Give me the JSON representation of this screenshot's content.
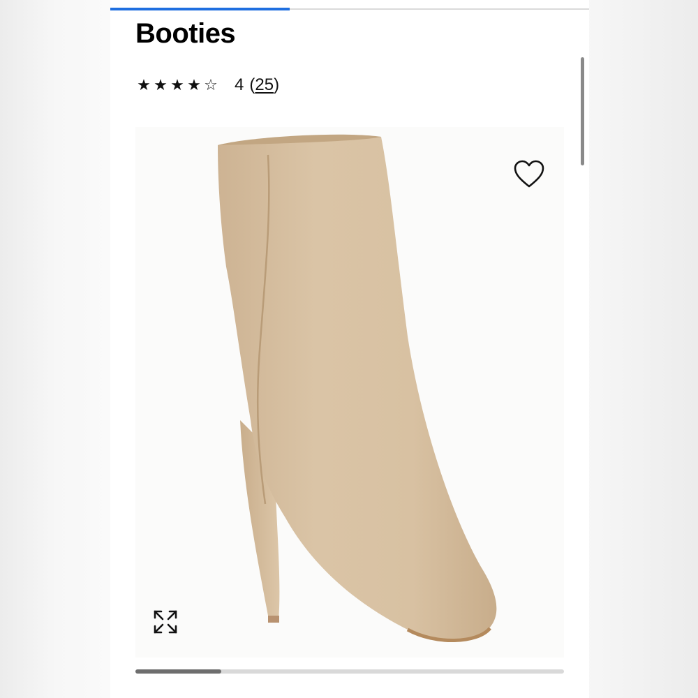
{
  "product": {
    "title": "Booties",
    "rating": {
      "stars_filled": 4,
      "stars_total": 5,
      "star_filled_glyph": "★",
      "star_empty_glyph": "☆",
      "value": "4",
      "count": "25",
      "count_open": "(",
      "count_close": ")"
    },
    "image": {
      "subject": "boot-photo",
      "boot_color": "#d9c2a4"
    }
  },
  "carousel": {
    "progress_fraction": 0.2
  },
  "top_loader": {
    "progress_fraction": 0.375,
    "color": "#1f6fe0"
  },
  "icons": {
    "wishlist": "heart-icon",
    "zoom": "expand-icon"
  }
}
